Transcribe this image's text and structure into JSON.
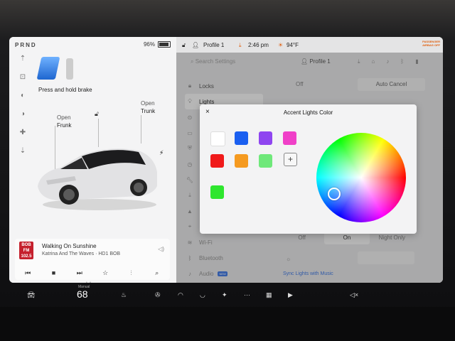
{
  "left": {
    "gears": "PRND",
    "battery": "96%",
    "battery_level": 0.96,
    "brake_prompt": "Press and hold brake",
    "trunk": {
      "open": "Open",
      "name": "Trunk"
    },
    "frunk": {
      "open": "Open",
      "name": "Frunk"
    }
  },
  "media": {
    "station_logo": "BOB FM 102.5",
    "song": "Walking On Sunshine",
    "artist": "Katrina And The Waves · HD1 BOB"
  },
  "topbar": {
    "profile": "Profile 1",
    "time": "2:46 pm",
    "temp": "94°F",
    "passenger_airbag_line1": "PASSENGER",
    "passenger_airbag_line2": "AIRBAG OFF"
  },
  "settings": {
    "search_placeholder": "Search Settings",
    "profile": "Profile 1",
    "menu": [
      {
        "label": "Locks",
        "icon": "lock-icon"
      },
      {
        "label": "Lights",
        "icon": "bulb-icon"
      },
      {
        "label": "",
        "icon": "steering-icon"
      },
      {
        "label": "",
        "icon": "display-icon"
      },
      {
        "label": "",
        "icon": "shield-icon"
      },
      {
        "label": "",
        "icon": "clock-icon"
      },
      {
        "label": "",
        "icon": "wrench-icon"
      },
      {
        "label": "",
        "icon": "download-icon"
      },
      {
        "label": "",
        "icon": "nav-icon"
      },
      {
        "label": "",
        "icon": "map-icon"
      },
      {
        "label": "Wi-Fi",
        "icon": "wifi-icon"
      },
      {
        "label": "Bluetooth",
        "icon": "bluetooth-icon"
      },
      {
        "label": "Audio",
        "icon": "audio-icon",
        "badge": "NEW"
      }
    ],
    "off_label": "Off",
    "auto_cancel": "Auto Cancel",
    "segment": [
      "Off",
      "On",
      "Night Only"
    ],
    "segment_selected": 1,
    "sync_link": "Sync Lights with Music"
  },
  "modal": {
    "title": "Accent Lights Color",
    "close": "×",
    "add": "+",
    "swatches": [
      "#ffffff",
      "#1a5ff0",
      "#8f45f0",
      "#f040c8",
      "#f01a1a",
      "#f59a20",
      "#6fe87a",
      "#2ee62e"
    ]
  },
  "dock": {
    "climate_mode": "Manual",
    "temperature": "68"
  }
}
